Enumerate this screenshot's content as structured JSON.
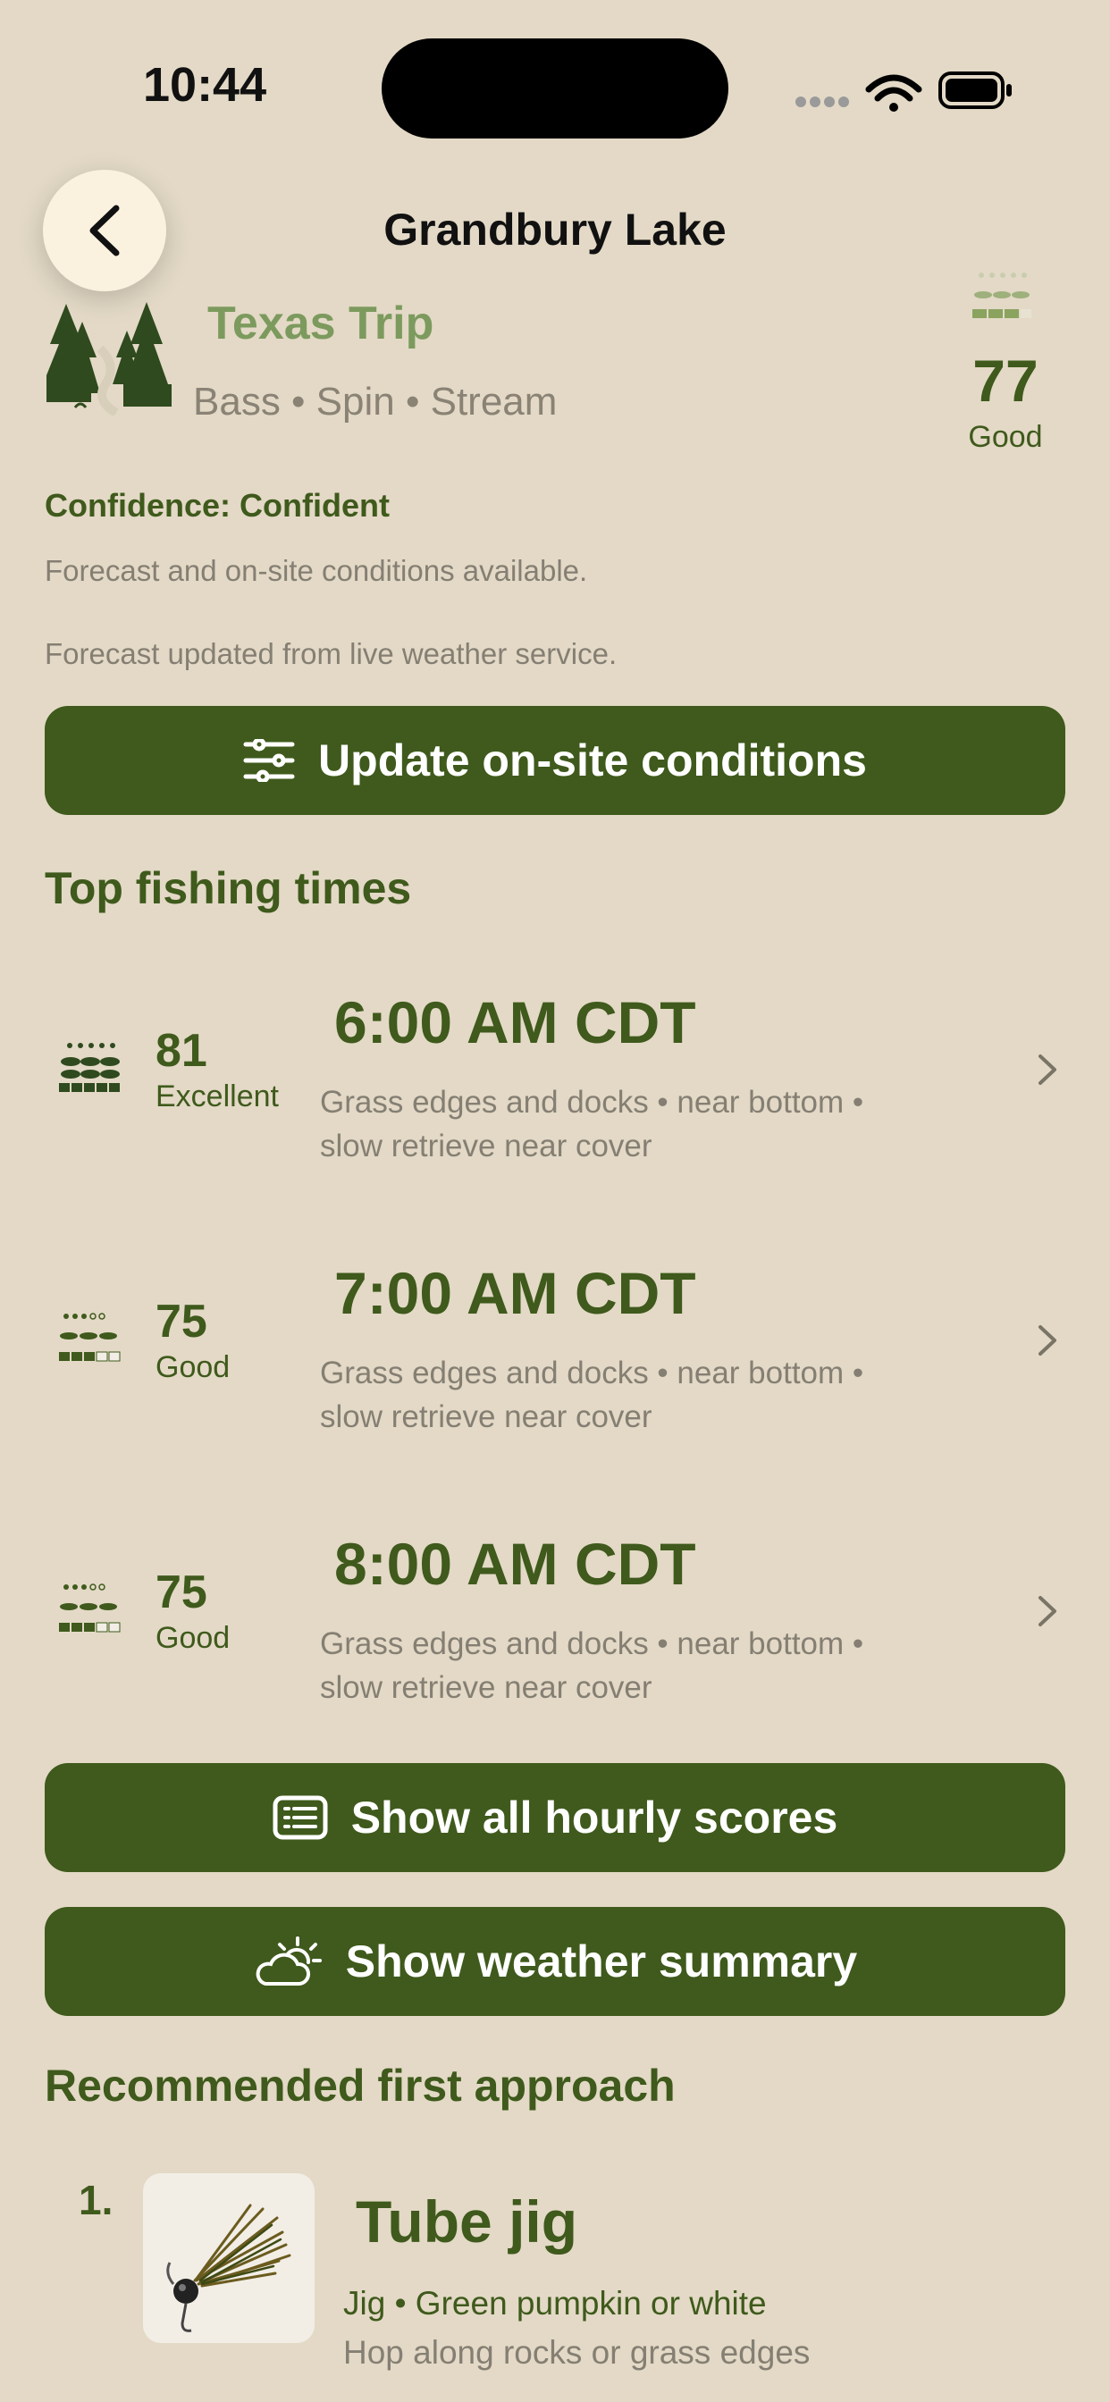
{
  "status": {
    "time": "10:44"
  },
  "nav": {
    "title": "Grandbury Lake"
  },
  "trip": {
    "name": "Texas Trip",
    "meta": "Bass • Spin • Stream",
    "score": "77",
    "score_label": "Good",
    "confidence": "Confidence: Confident",
    "notes": [
      "Forecast and on-site conditions available.",
      "Forecast updated from live weather service."
    ]
  },
  "buttons": {
    "update_conditions": "Update on-site conditions",
    "show_hourly": "Show all hourly scores",
    "show_weather": "Show weather summary"
  },
  "top_times": {
    "heading": "Top fishing times",
    "items": [
      {
        "score": "81",
        "label": "Excellent",
        "stars": 5,
        "time": "6:00 AM CDT",
        "desc1": "Grass edges and docks • near bottom •",
        "desc2": "slow retrieve near cover"
      },
      {
        "score": "75",
        "label": "Good",
        "stars": 3,
        "time": "7:00 AM CDT",
        "desc1": "Grass edges and docks • near bottom •",
        "desc2": "slow retrieve near cover"
      },
      {
        "score": "75",
        "label": "Good",
        "stars": 3,
        "time": "8:00 AM CDT",
        "desc1": "Grass edges and docks • near bottom •",
        "desc2": "slow retrieve near cover"
      }
    ]
  },
  "approach": {
    "heading": "Recommended first approach",
    "items": [
      {
        "number": "1.",
        "name": "Tube jig",
        "sub": "Jig • Green pumpkin or white",
        "desc": "Hop along rocks or grass edges"
      }
    ]
  },
  "colors": {
    "background": "#e3d9c6",
    "accent": "#3f5a1c",
    "muted_text": "#857f73",
    "trip_name": "#7c9a5e"
  },
  "icons": {
    "back": "chevron-left-icon",
    "update": "sliders-icon",
    "hourly": "list-icon",
    "weather": "sun-cloud-icon",
    "row_chevron": "chevron-right-icon"
  }
}
